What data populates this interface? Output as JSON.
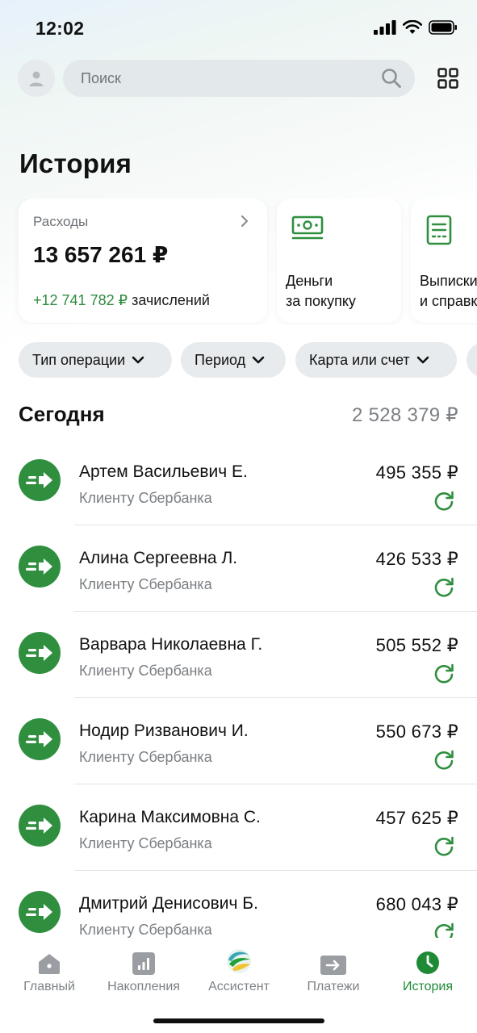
{
  "status_bar": {
    "time": "12:02"
  },
  "search": {
    "placeholder": "Поиск"
  },
  "page_title": "История",
  "cards": {
    "expenses": {
      "label": "Расходы",
      "amount": "13 657 261 ₽",
      "income_amount": "+12 741 782 ₽",
      "income_suffix": " зачислений"
    },
    "money_back": {
      "line1": "Деньги",
      "line2": "за покупку",
      "icon": "cash-icon"
    },
    "statements": {
      "line1": "Выписки",
      "line2": "и справки",
      "icon": "document-icon"
    }
  },
  "filters": [
    "Тип операции",
    "Период",
    "Карта или счет",
    ""
  ],
  "section": {
    "title": "Сегодня",
    "total": "2 528 379 ₽"
  },
  "transactions": [
    {
      "name": "Артем Васильевич Е.",
      "subtitle": "Клиенту Сбербанка",
      "amount": "495 355 ₽"
    },
    {
      "name": "Алина Сергеевна Л.",
      "subtitle": "Клиенту Сбербанка",
      "amount": "426 533 ₽"
    },
    {
      "name": "Варвара Николаевна Г.",
      "subtitle": "Клиенту Сбербанка",
      "amount": "505 552 ₽"
    },
    {
      "name": "Нодир Ризванович И.",
      "subtitle": "Клиенту Сбербанка",
      "amount": "550 673 ₽"
    },
    {
      "name": "Карина Максимовна С.",
      "subtitle": "Клиенту Сбербанка",
      "amount": "457 625 ₽"
    },
    {
      "name": "Дмитрий Денисович Б.",
      "subtitle": "Клиенту Сбербанка",
      "amount": "680 043 ₽"
    }
  ],
  "tabbar": {
    "items": [
      {
        "label": "Главный",
        "icon": "home-icon"
      },
      {
        "label": "Накопления",
        "icon": "savings-chart-icon"
      },
      {
        "label": "Ассистент",
        "icon": "assistant-icon"
      },
      {
        "label": "Платежи",
        "icon": "payments-icon"
      },
      {
        "label": "История",
        "icon": "history-clock-icon"
      }
    ],
    "active": "История"
  },
  "colors": {
    "accent": "#2f8f3f",
    "positive": "#2e8b3e",
    "active_tab": "#1f8a35"
  }
}
